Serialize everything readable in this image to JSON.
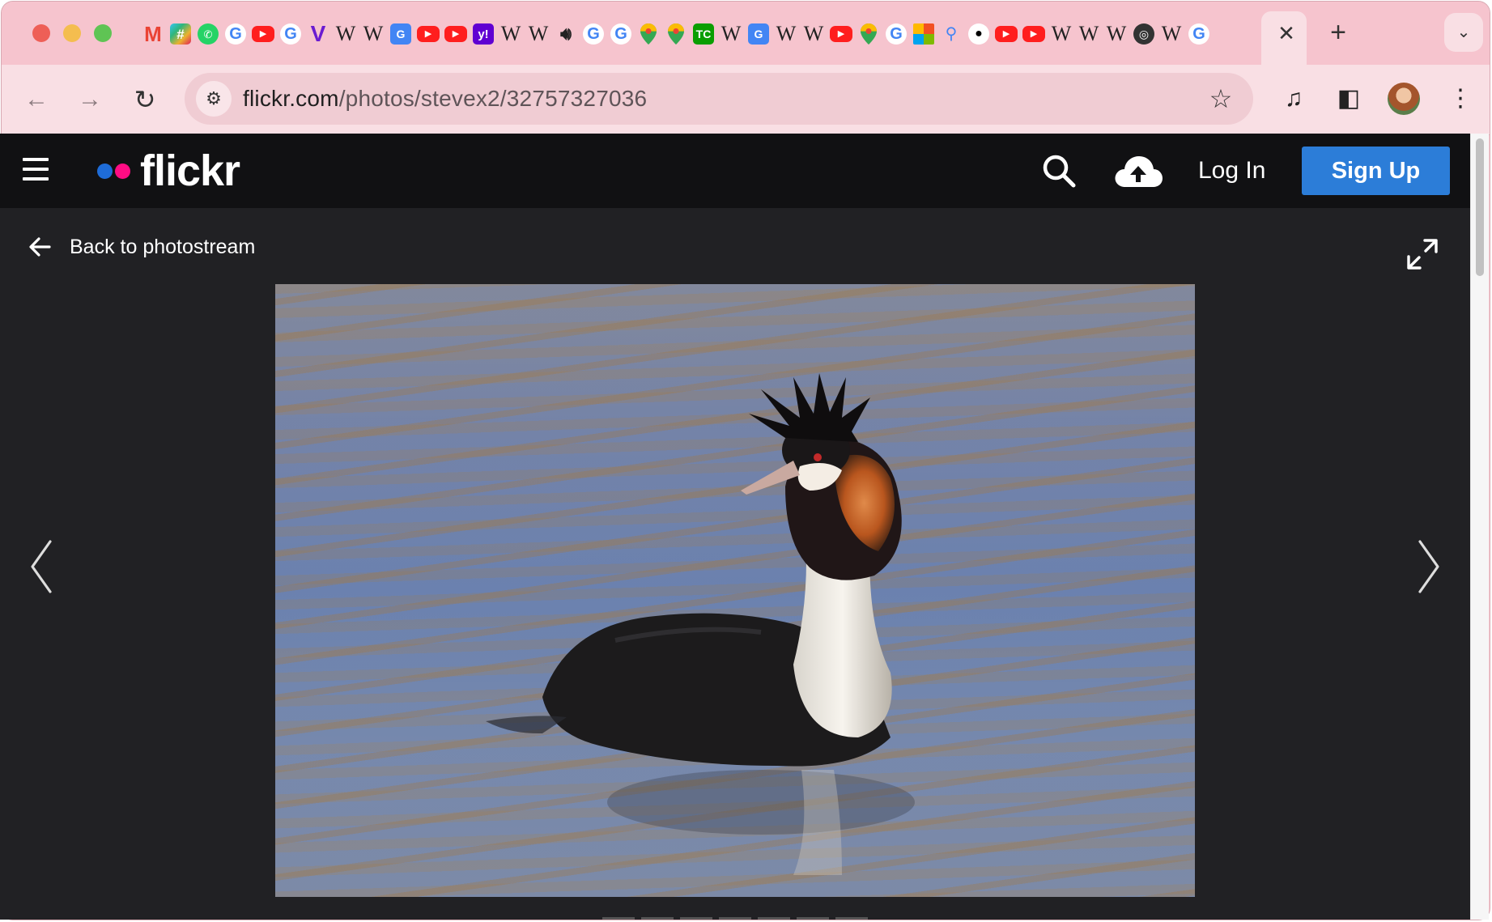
{
  "browser": {
    "tab_favicons": [
      "gmail-icon",
      "slack-icon",
      "whatsapp-icon",
      "google-icon",
      "youtube-icon",
      "google-icon",
      "v-icon",
      "wikipedia-icon",
      "wikipedia-icon",
      "translate-icon",
      "youtube-icon",
      "youtube-icon",
      "yahoo-icon",
      "wikipedia-icon",
      "wikipedia-icon",
      "speaker-icon",
      "google-icon",
      "google-icon",
      "maps-icon",
      "maps-icon",
      "techcrunch-icon",
      "wikipedia-icon",
      "translate-icon",
      "wikipedia-icon",
      "wikipedia-icon",
      "youtube-icon",
      "maps-icon",
      "google-icon",
      "microsoft-icon",
      "lens-icon",
      "apple-icon",
      "youtube-icon",
      "youtube-icon",
      "wikipedia-icon",
      "wikipedia-icon",
      "wikipedia-icon",
      "chrome-icon",
      "wikipedia-icon",
      "google-icon"
    ],
    "url_host": "flickr.com",
    "url_path": "/photos/stevex2/32757327036"
  },
  "header": {
    "logo": "flickr",
    "login_label": "Log In",
    "signup_label": "Sign Up"
  },
  "nav": {
    "back_label": "Back to photostream"
  },
  "colors": {
    "signup": "#2c7dd8",
    "logo_blue": "#1e6cd8",
    "logo_pink": "#ff0c84",
    "page_bg": "#212124",
    "header_bg": "#111113",
    "tabstrip": "#f6c4ce"
  }
}
